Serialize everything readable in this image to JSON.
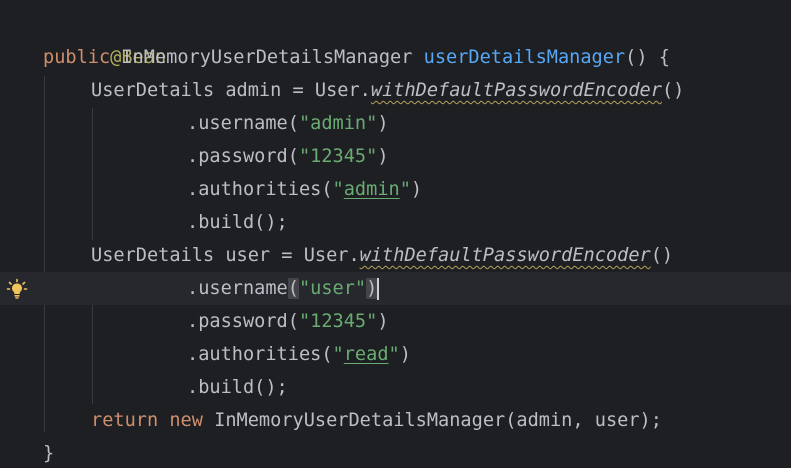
{
  "editor": {
    "lines": [
      {
        "annotation": "@Bean"
      },
      {
        "kw_public": "public",
        "type": " InMemoryUserDetailsManager ",
        "method": "userDetailsManager",
        "rest": "() {"
      },
      {
        "decl": "UserDetails admin = User.",
        "static_call": "withDefaultPasswordEncoder",
        "rest": "()"
      },
      {
        "call": ".username(",
        "str": "\"admin\"",
        "rest": ")"
      },
      {
        "call": ".password(",
        "str": "\"12345\"",
        "rest": ")"
      },
      {
        "call": ".authorities(",
        "str_q1": "\"",
        "str_link": "admin",
        "str_q2": "\"",
        "rest": ")"
      },
      {
        "call": ".build();"
      },
      {
        "decl": "UserDetails user = User.",
        "static_call": "withDefaultPasswordEncoder",
        "rest": "()"
      },
      {
        "call": ".username",
        "paren_open": "(",
        "str": "\"user\"",
        "paren_close": ")"
      },
      {
        "call": ".password(",
        "str": "\"12345\"",
        "rest": ")"
      },
      {
        "call": ".authorities(",
        "str_q1": "\"",
        "str_link": "read",
        "str_q2": "\"",
        "rest": ")"
      },
      {
        "call": ".build();"
      },
      {
        "kw_return": "return",
        "kw_new": " new",
        "rest": " InMemoryUserDetailsManager(admin, user);"
      },
      {
        "rest": "}"
      }
    ],
    "current_line_index": 8,
    "gutter_icon": "lightbulb-icon",
    "colors": {
      "background": "#1e1f22",
      "current_line": "#26282e",
      "keyword": "#cf8e6d",
      "annotation": "#b3ae60",
      "method_declaration": "#56a8f5",
      "string": "#6aab73",
      "text": "#bcbec4",
      "lightbulb": "#f2c55c"
    }
  }
}
